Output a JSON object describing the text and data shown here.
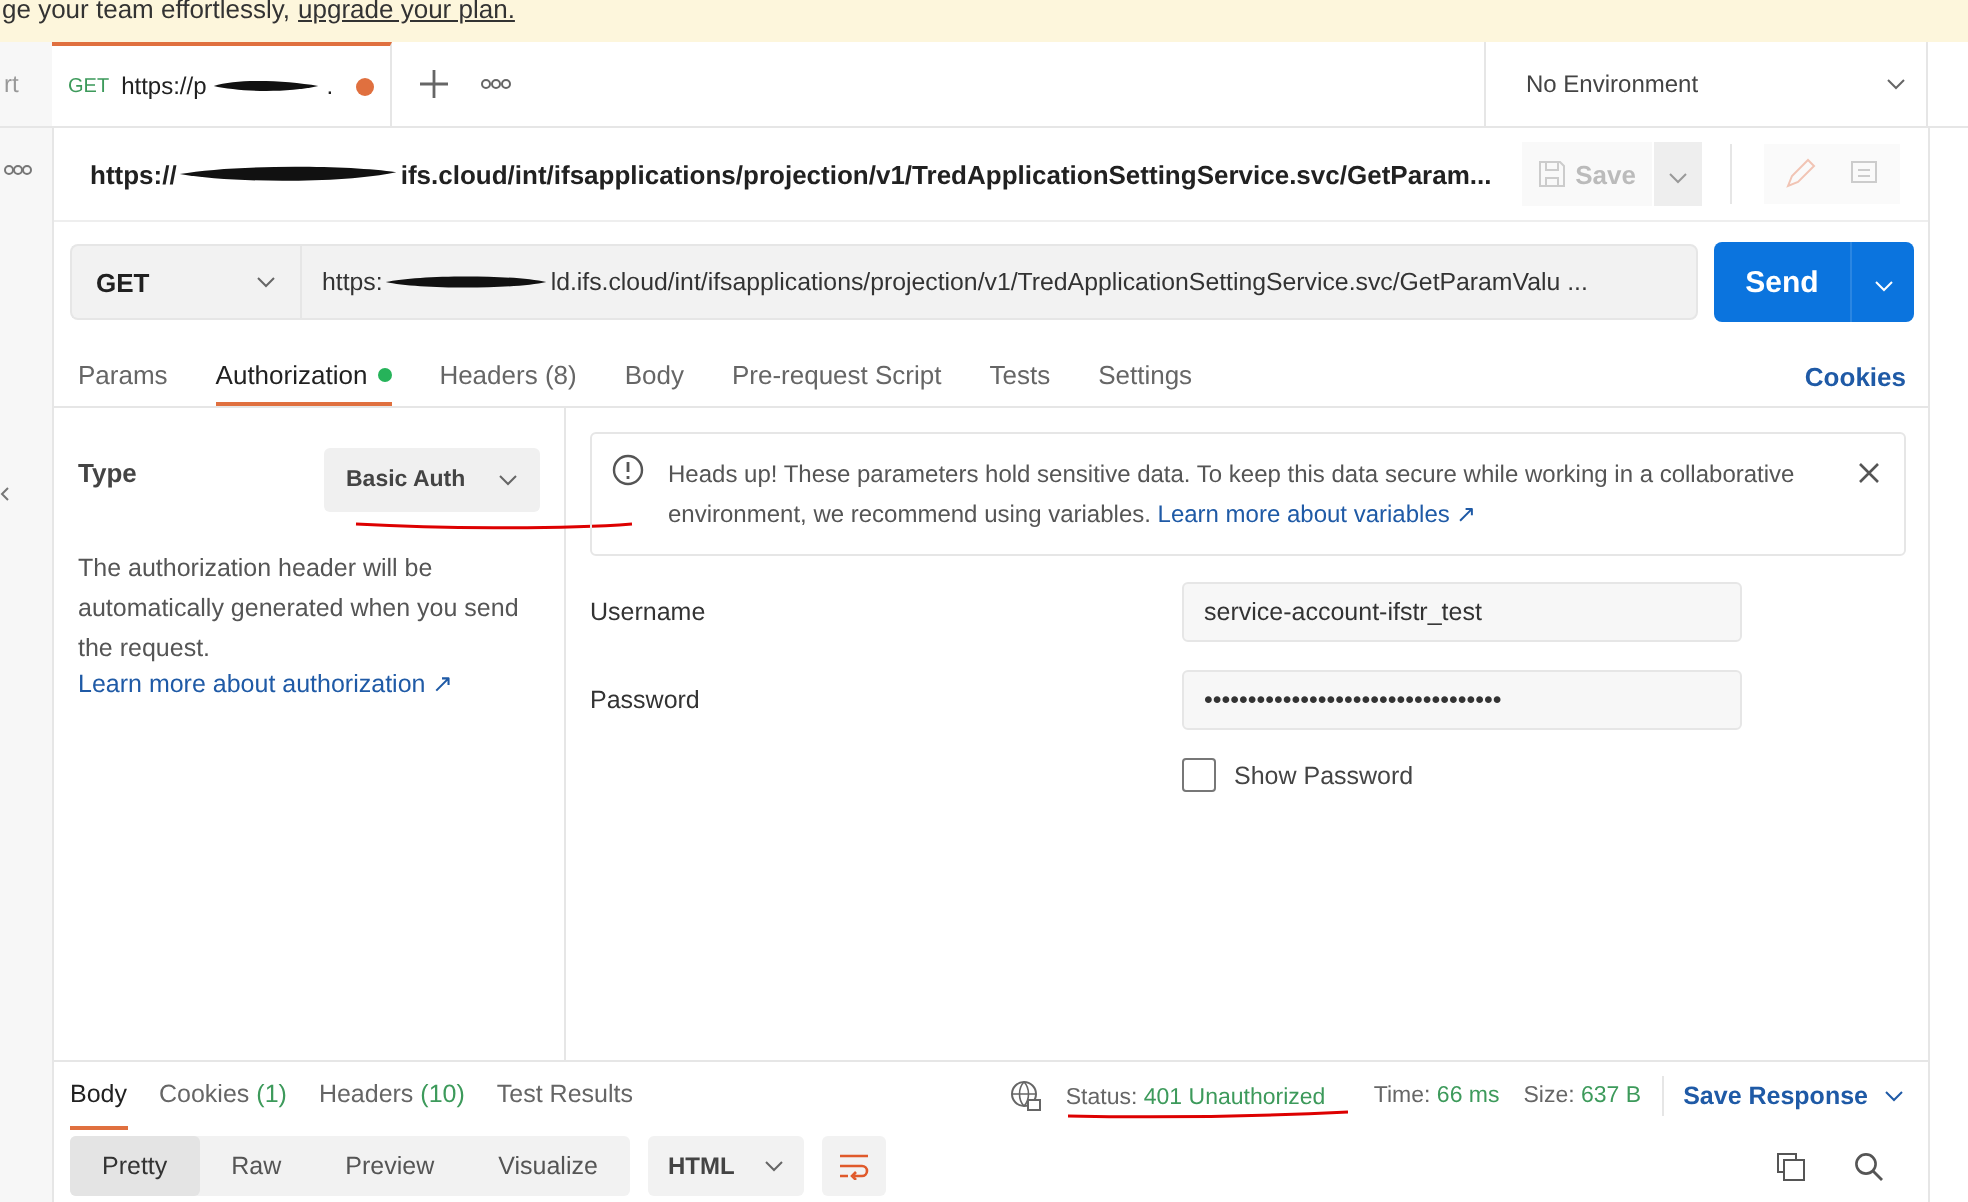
{
  "banner": {
    "text": "ge your team effortlessly,",
    "link": "upgrade your plan."
  },
  "left_stub": {
    "tab": "rt"
  },
  "tabs": [
    {
      "method": "GET",
      "title_prefix": "https://p",
      "title_suffix": ".",
      "unsaved": true,
      "selected": true
    }
  ],
  "environment": "No Environment",
  "request": {
    "name_prefix": "https://",
    "name_suffix": "ifs.cloud/int/ifsapplications/projection/v1/TredApplicationSettingService.svc/GetParam...",
    "save": "Save"
  },
  "url": {
    "method": "GET",
    "prefix": "https:",
    "suffix": "ld.ifs.cloud/int/ifsapplications/projection/v1/TredApplicationSettingService.svc/GetParamValu ...",
    "send": "Send"
  },
  "request_tabs": [
    {
      "label": "Params",
      "selected": false,
      "indicator": false
    },
    {
      "label": "Authorization",
      "selected": true,
      "indicator": true
    },
    {
      "label": "Headers",
      "count": "(8)",
      "selected": false,
      "indicator": false
    },
    {
      "label": "Body",
      "selected": false,
      "indicator": false
    },
    {
      "label": "Pre-request Script",
      "selected": false,
      "indicator": false
    },
    {
      "label": "Tests",
      "selected": false,
      "indicator": false
    },
    {
      "label": "Settings",
      "selected": false,
      "indicator": false
    }
  ],
  "cookies_link": "Cookies",
  "auth": {
    "type_label": "Type",
    "type_value": "Basic Auth",
    "description": "The authorization header will be automatically generated when you send the request.",
    "learn_link": "Learn more about authorization ↗",
    "notice": {
      "text": "Heads up! These parameters hold sensitive data. To keep this data secure while working in a collaborative environment, we recommend using variables.",
      "link": "Learn more about variables ↗"
    },
    "fields": [
      {
        "label": "Username",
        "value": "service-account-ifstr_test"
      },
      {
        "label": "Password",
        "value": "••••••••••••••••••••••••••••••••••"
      }
    ],
    "show_password": {
      "label": "Show Password",
      "checked": false
    }
  },
  "response": {
    "tabs": [
      {
        "label": "Body",
        "selected": true
      },
      {
        "label": "Cookies",
        "count": "(1)",
        "selected": false
      },
      {
        "label": "Headers",
        "count": "(10)",
        "selected": false
      },
      {
        "label": "Test Results",
        "selected": false
      }
    ],
    "status_label": "Status:",
    "status": "401 Unauthorized",
    "time_label": "Time:",
    "time": "66 ms",
    "size_label": "Size:",
    "size": "637 B",
    "save_response": "Save Response",
    "view_modes": [
      {
        "label": "Pretty",
        "selected": true
      },
      {
        "label": "Raw",
        "selected": false
      },
      {
        "label": "Preview",
        "selected": false
      },
      {
        "label": "Visualize",
        "selected": false
      }
    ],
    "format": "HTML"
  }
}
